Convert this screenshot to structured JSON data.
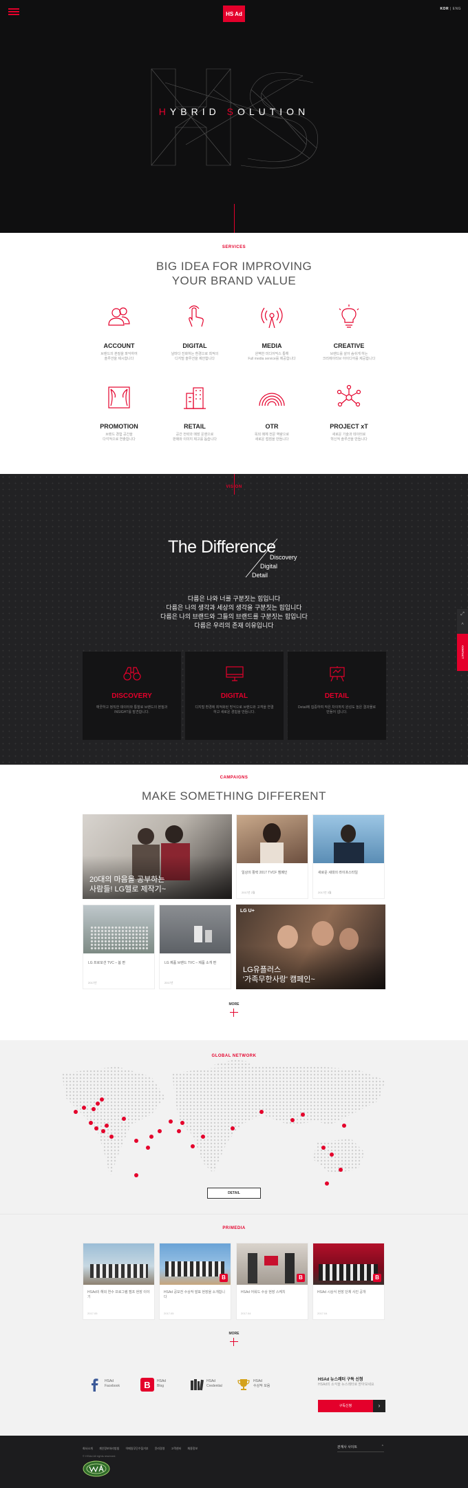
{
  "header": {
    "logo": "HS Ad",
    "lang_active": "KOR",
    "lang_sep": "|",
    "lang_other": "ENG"
  },
  "hero": {
    "title_h": "H",
    "title_a": "YBRID ",
    "title_s": "S",
    "title_b": "OLUTION"
  },
  "services": {
    "label": "SERVICES",
    "title_line1": "BIG IDEA FOR IMPROVING",
    "title_line2": "YOUR BRAND VALUE",
    "items": [
      {
        "name": "ACCOUNT",
        "icon": "account-icon",
        "desc1": "브랜드의 본질을 파악하여",
        "desc2": "솔루션을 제시합니다"
      },
      {
        "name": "DIGITAL",
        "icon": "touch-icon",
        "desc1": "날마다 진화하는 환경으로 최적의",
        "desc2": "디지털 솔루션을 제안합니다"
      },
      {
        "name": "MEDIA",
        "icon": "broadcast-icon",
        "desc1": "완벽한 미디어믹스 통해",
        "desc2": "Full media service를 제공합니다"
      },
      {
        "name": "CREATIVE",
        "icon": "lightbulb-icon",
        "desc1": "브랜드를 살아 숨쉬게 하는",
        "desc2": "크리에이티브 아이디어를 제공합니다"
      },
      {
        "name": "PROMOTION",
        "icon": "curtain-icon",
        "desc1": "브랜드 경험 공간을",
        "desc2": "다각적으로 연출합니다"
      },
      {
        "name": "RETAIL",
        "icon": "building-icon",
        "desc1": "공간 전략과 매장 운영으로",
        "desc2": "판매와 이미지 제고를 돕습니다"
      },
      {
        "name": "OTR",
        "icon": "rainbow-icon",
        "desc1": "옥외 매체 전문 역량으로",
        "desc2": "새로운 접점을 만듭니다"
      },
      {
        "name": "PROJECT xT",
        "icon": "network-icon",
        "desc1": "새로운 기술과 데이터로",
        "desc2": "혁신적 솔루션을 만듭니다"
      }
    ]
  },
  "vision": {
    "label": "VISION",
    "title": "The Difference",
    "sub1": "Discovery",
    "sub2": "Digital",
    "sub3": "Detail",
    "lines": [
      "다름은 나와 너를 구분짓는 힘입니다",
      "다름은 나의 생각과 세상의 생각을 구분짓는 힘입니다",
      "다름은 나의 브랜드와 그들의 브랜드를 구분짓는 힘입니다",
      "다름은 우리의 존재 이유입니다"
    ],
    "cards": [
      {
        "name": "DISCOVERY",
        "icon": "binoculars-icon",
        "desc": "깨끗하고 정직한 데이터와 통찰로 브랜드의 본질과 INSIGHT를 발견합니다."
      },
      {
        "name": "DIGITAL",
        "icon": "monitor-icon",
        "desc": "디지털 환경에 최적화된 방식으로 브랜드와 고객을 연결하고 새로운 경험을 만듭니다."
      },
      {
        "name": "DETAIL",
        "icon": "easel-icon",
        "desc": "Detail에 집중하여 작은 차이까지 완성도 높은 결과물로 만들어 냅니다."
      }
    ]
  },
  "campaigns": {
    "label": "CAMPAIGNS",
    "title": "MAKE SOMETHING DIFFERENT",
    "big1_caption1": "20대의 마음을 공부하는",
    "big1_caption2": "사람들! LG헬로 제작기~",
    "small": [
      {
        "text": "일상의 활력 2017 TVCF 캠페인",
        "date": "2017년 2월"
      },
      {
        "text": "새로운 세대의 라이프스타일",
        "date": "2017년 3월"
      },
      {
        "text": "LG 프로모션 TVC – 봄 편",
        "date": "2017년"
      },
      {
        "text": "LG 제품 브랜드 TVC – 제품 소개 편",
        "date": "2017년"
      }
    ],
    "big2_tag": "LG U+",
    "big2_caption1": "LG유플러스",
    "big2_caption2": "'가족무한사랑' 캠페인~",
    "more": "MORE"
  },
  "network": {
    "label": "GLOBAL NETWORK",
    "button": "DETAIL"
  },
  "pr": {
    "label": "PR/MEDIA",
    "cards": [
      {
        "text": "HSAd의 해외 연수 프로그램 캠프 현장 이야기",
        "date": "2017.05"
      },
      {
        "text": "HSAd 공모전 수상작 발표 현장을 소개합니다",
        "date": "2017.05"
      },
      {
        "text": "HSAd 어워드 수상 현장 스케치",
        "date": "2017.04"
      },
      {
        "text": "HSAd 시상식 현장 단체 사진 공개",
        "date": "2017.04"
      }
    ],
    "more": "MORE"
  },
  "social": [
    {
      "icon": "facebook-icon",
      "line1": "HSAd",
      "line2": "Facebook"
    },
    {
      "icon": "blog-icon",
      "line1": "HSAd",
      "line2": "Blog"
    },
    {
      "icon": "books-icon",
      "line1": "HSAd",
      "line2": "Credential"
    },
    {
      "icon": "trophy-icon",
      "line1": "HSAd",
      "line2": "수상작 모음"
    }
  ],
  "subscribe": {
    "title": "HSAd 뉴스레터 구독 신청",
    "text": "HSAd의 소식을 뉴스레터로 받아보세요",
    "button": "구독신청",
    "arrow": "›"
  },
  "footer": {
    "links": [
      "회사소개",
      "개인정보처리방침",
      "이메일무단수집거부",
      "윤리경영",
      "고객센터",
      "채용정보"
    ],
    "copyright": "© HSAd All rights reserved.",
    "family": "관계사 사이트"
  },
  "side": {
    "contact": "CONTACT"
  },
  "colors": {
    "accent": "#e4002b",
    "dark": "#1c1c1e"
  }
}
